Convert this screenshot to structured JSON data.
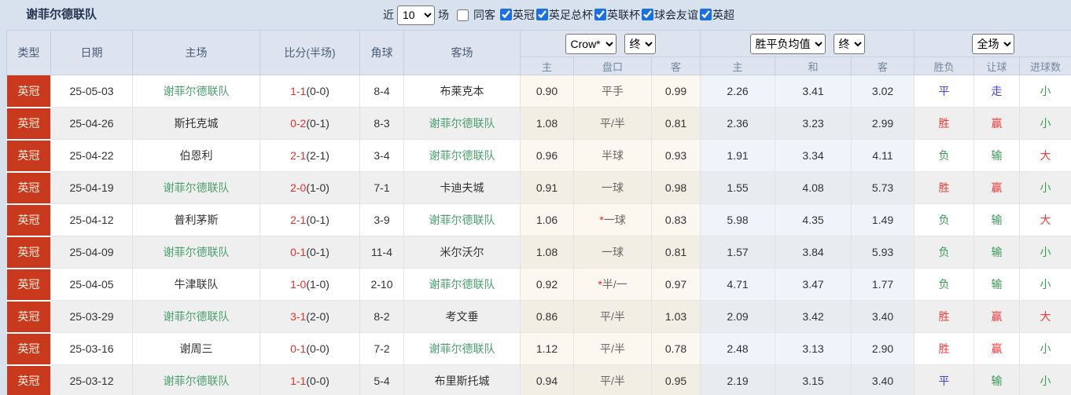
{
  "title": "谢菲尔德联队",
  "toolbar": {
    "recent_label": "近",
    "recent_count": "10",
    "matches_label": "场",
    "same_opponent": {
      "label": "同客",
      "checked": false
    },
    "league_filters": [
      {
        "label": "英冠",
        "checked": true
      },
      {
        "label": "英足总杯",
        "checked": true
      },
      {
        "label": "英联杯",
        "checked": true
      },
      {
        "label": "球会友谊",
        "checked": true
      },
      {
        "label": "英超",
        "checked": true
      }
    ]
  },
  "colors": {
    "badge_bg": "#c8391e",
    "team_highlight": "#4a9e6e",
    "result_red": "#f23b3b",
    "result_green": "#3a9b55",
    "result_blue": "#4444f4",
    "score_red": "#e93030"
  },
  "table": {
    "columns": [
      "类型",
      "日期",
      "主场",
      "比分(半场)",
      "角球",
      "客场"
    ],
    "odds_group_selects": [
      "Crow*",
      "终"
    ],
    "avg_group_selects": [
      "胜平负均值",
      "终"
    ],
    "scope_select": "全场",
    "sub_headers": [
      "主",
      "盘口",
      "客",
      "主",
      "和",
      "客",
      "胜负",
      "让球",
      "进球数"
    ],
    "rows": [
      {
        "league": "英冠",
        "date": "25-05-03",
        "home": "谢菲尔德联队",
        "home_active": true,
        "score": "1-1",
        "half": "(0-0)",
        "corner": "8-4",
        "away": "布莱克本",
        "away_active": false,
        "odds_home": "0.90",
        "handicap": "平手",
        "handicap_star": false,
        "odds_away": "0.99",
        "avg_home": "2.26",
        "avg_draw": "3.41",
        "avg_away": "3.02",
        "outcome": "平",
        "outcome_color": "blue",
        "handicap_result": "走",
        "handicap_result_color": "blue",
        "goals": "小",
        "goals_color": "green"
      },
      {
        "league": "英冠",
        "date": "25-04-26",
        "home": "斯托克城",
        "home_active": false,
        "score": "0-2",
        "half": "(0-1)",
        "corner": "8-3",
        "away": "谢菲尔德联队",
        "away_active": true,
        "odds_home": "1.08",
        "handicap": "平/半",
        "handicap_star": false,
        "odds_away": "0.81",
        "avg_home": "2.36",
        "avg_draw": "3.23",
        "avg_away": "2.99",
        "outcome": "胜",
        "outcome_color": "red",
        "handicap_result": "赢",
        "handicap_result_color": "red",
        "goals": "小",
        "goals_color": "green"
      },
      {
        "league": "英冠",
        "date": "25-04-22",
        "home": "伯恩利",
        "home_active": false,
        "score": "2-1",
        "half": "(2-1)",
        "corner": "3-4",
        "away": "谢菲尔德联队",
        "away_active": true,
        "odds_home": "0.96",
        "handicap": "半球",
        "handicap_star": false,
        "odds_away": "0.93",
        "avg_home": "1.91",
        "avg_draw": "3.34",
        "avg_away": "4.11",
        "outcome": "负",
        "outcome_color": "green",
        "handicap_result": "输",
        "handicap_result_color": "green",
        "goals": "大",
        "goals_color": "red"
      },
      {
        "league": "英冠",
        "date": "25-04-19",
        "home": "谢菲尔德联队",
        "home_active": true,
        "score": "2-0",
        "half": "(1-0)",
        "corner": "7-1",
        "away": "卡迪夫城",
        "away_active": false,
        "odds_home": "0.91",
        "handicap": "一球",
        "handicap_star": false,
        "odds_away": "0.98",
        "avg_home": "1.55",
        "avg_draw": "4.08",
        "avg_away": "5.73",
        "outcome": "胜",
        "outcome_color": "red",
        "handicap_result": "赢",
        "handicap_result_color": "red",
        "goals": "小",
        "goals_color": "green"
      },
      {
        "league": "英冠",
        "date": "25-04-12",
        "home": "普利茅斯",
        "home_active": false,
        "score": "2-1",
        "half": "(0-1)",
        "corner": "3-9",
        "away": "谢菲尔德联队",
        "away_active": true,
        "odds_home": "1.06",
        "handicap": "一球",
        "handicap_star": true,
        "odds_away": "0.83",
        "avg_home": "5.98",
        "avg_draw": "4.35",
        "avg_away": "1.49",
        "outcome": "负",
        "outcome_color": "green",
        "handicap_result": "输",
        "handicap_result_color": "green",
        "goals": "大",
        "goals_color": "red"
      },
      {
        "league": "英冠",
        "date": "25-04-09",
        "home": "谢菲尔德联队",
        "home_active": true,
        "score": "0-1",
        "half": "(0-1)",
        "corner": "11-4",
        "away": "米尔沃尔",
        "away_active": false,
        "odds_home": "1.08",
        "handicap": "一球",
        "handicap_star": false,
        "odds_away": "0.81",
        "avg_home": "1.57",
        "avg_draw": "3.84",
        "avg_away": "5.93",
        "outcome": "负",
        "outcome_color": "green",
        "handicap_result": "输",
        "handicap_result_color": "green",
        "goals": "小",
        "goals_color": "green"
      },
      {
        "league": "英冠",
        "date": "25-04-05",
        "home": "牛津联队",
        "home_active": false,
        "score": "1-0",
        "half": "(1-0)",
        "corner": "2-10",
        "away": "谢菲尔德联队",
        "away_active": true,
        "odds_home": "0.92",
        "handicap": "半/一",
        "handicap_star": true,
        "odds_away": "0.97",
        "avg_home": "4.71",
        "avg_draw": "3.47",
        "avg_away": "1.77",
        "outcome": "负",
        "outcome_color": "green",
        "handicap_result": "输",
        "handicap_result_color": "green",
        "goals": "小",
        "goals_color": "green"
      },
      {
        "league": "英冠",
        "date": "25-03-29",
        "home": "谢菲尔德联队",
        "home_active": true,
        "score": "3-1",
        "half": "(2-0)",
        "corner": "8-2",
        "away": "考文垂",
        "away_active": false,
        "odds_home": "0.86",
        "handicap": "平/半",
        "handicap_star": false,
        "odds_away": "1.03",
        "avg_home": "2.09",
        "avg_draw": "3.42",
        "avg_away": "3.40",
        "outcome": "胜",
        "outcome_color": "red",
        "handicap_result": "赢",
        "handicap_result_color": "red",
        "goals": "大",
        "goals_color": "red"
      },
      {
        "league": "英冠",
        "date": "25-03-16",
        "home": "谢周三",
        "home_active": false,
        "score": "0-1",
        "half": "(0-0)",
        "corner": "7-2",
        "away": "谢菲尔德联队",
        "away_active": true,
        "odds_home": "1.12",
        "handicap": "平/半",
        "handicap_star": false,
        "odds_away": "0.78",
        "avg_home": "2.48",
        "avg_draw": "3.13",
        "avg_away": "2.90",
        "outcome": "胜",
        "outcome_color": "red",
        "handicap_result": "赢",
        "handicap_result_color": "red",
        "goals": "小",
        "goals_color": "green"
      },
      {
        "league": "英冠",
        "date": "25-03-12",
        "home": "谢菲尔德联队",
        "home_active": true,
        "score": "1-1",
        "half": "(0-0)",
        "corner": "5-4",
        "away": "布里斯托城",
        "away_active": false,
        "odds_home": "0.94",
        "handicap": "平/半",
        "handicap_star": false,
        "odds_away": "0.95",
        "avg_home": "2.19",
        "avg_draw": "3.15",
        "avg_away": "3.40",
        "outcome": "平",
        "outcome_color": "blue",
        "handicap_result": "输",
        "handicap_result_color": "green",
        "goals": "小",
        "goals_color": "green"
      }
    ]
  }
}
